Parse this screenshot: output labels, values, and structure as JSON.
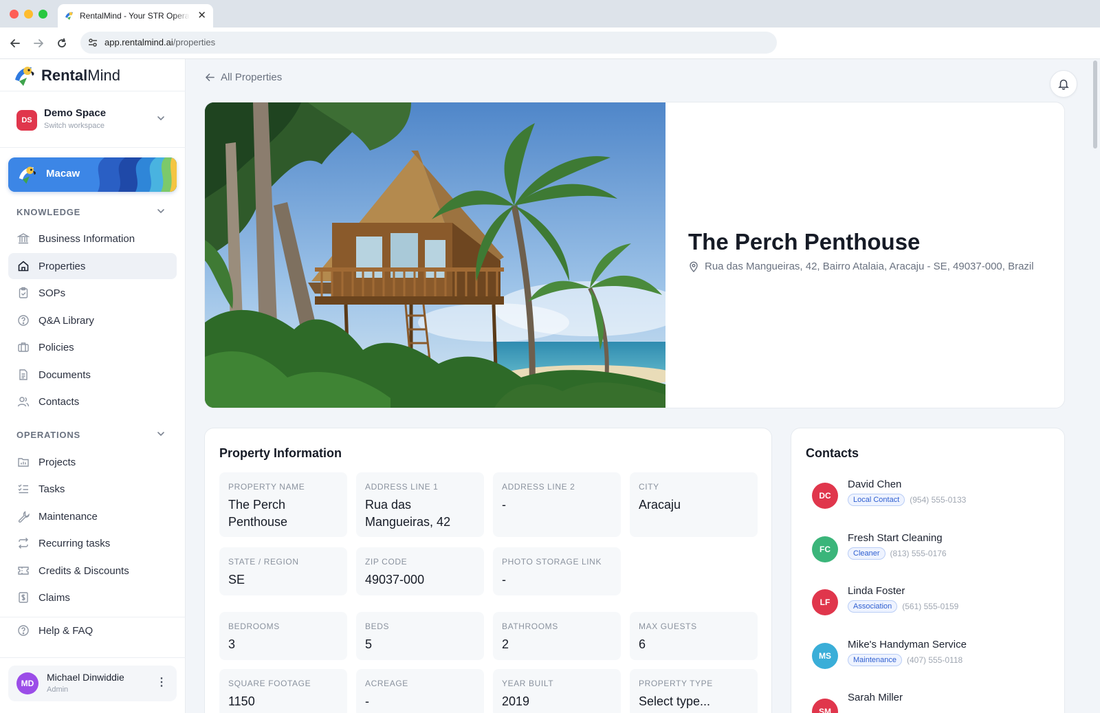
{
  "browser": {
    "tab_title": "RentalMind - Your STR Operations",
    "url_domain": "app.rentalmind.ai",
    "url_path": "/properties"
  },
  "sidebar": {
    "brand_first": "Rental",
    "brand_second": "Mind",
    "workspace": {
      "initials": "DS",
      "name": "Demo Space",
      "subtitle": "Switch workspace",
      "color": "#e0364c"
    },
    "macaw_label": "Macaw",
    "knowledge_heading": "KNOWLEDGE",
    "knowledge_items": [
      {
        "label": "Business Information",
        "icon": "bank-icon"
      },
      {
        "label": "Properties",
        "icon": "home-icon",
        "active": true
      },
      {
        "label": "SOPs",
        "icon": "clipboard-check-icon"
      },
      {
        "label": "Q&A Library",
        "icon": "question-circle-icon"
      },
      {
        "label": "Policies",
        "icon": "briefcase-icon"
      },
      {
        "label": "Documents",
        "icon": "document-icon"
      },
      {
        "label": "Contacts",
        "icon": "users-icon"
      }
    ],
    "operations_heading": "OPERATIONS",
    "operations_items": [
      {
        "label": "Projects",
        "icon": "folder-chart-icon"
      },
      {
        "label": "Tasks",
        "icon": "checklist-icon"
      },
      {
        "label": "Maintenance",
        "icon": "wrench-icon"
      },
      {
        "label": "Recurring tasks",
        "icon": "repeat-icon"
      },
      {
        "label": "Credits & Discounts",
        "icon": "ticket-icon"
      },
      {
        "label": "Claims",
        "icon": "dollar-file-icon"
      }
    ],
    "help_label": "Help & FAQ",
    "user": {
      "initials": "MD",
      "name": "Michael Dinwiddie",
      "role": "Admin",
      "color": "#9b4de8"
    }
  },
  "main": {
    "back_label": "All Properties",
    "property": {
      "title": "The Perch Penthouse",
      "address": "Rua das Mangueiras, 42, Bairro Atalaia, Aracaju - SE, 49037-000, Brazil"
    },
    "info_title": "Property Information",
    "fields": [
      {
        "label": "PROPERTY NAME",
        "value": "The Perch Penthouse"
      },
      {
        "label": "ADDRESS LINE 1",
        "value": "Rua das Mangueiras, 42"
      },
      {
        "label": "ADDRESS LINE 2",
        "value": "-"
      },
      {
        "label": "CITY",
        "value": "Aracaju"
      },
      {
        "label": "STATE / REGION",
        "value": "SE"
      },
      {
        "label": "ZIP CODE",
        "value": "49037-000"
      },
      {
        "label": "PHOTO STORAGE LINK",
        "value": "-"
      },
      {
        "label": "BEDROOMS",
        "value": "3"
      },
      {
        "label": "BEDS",
        "value": "5"
      },
      {
        "label": "BATHROOMS",
        "value": "2"
      },
      {
        "label": "MAX GUESTS",
        "value": "6"
      },
      {
        "label": "SQUARE FOOTAGE",
        "value": "1150"
      },
      {
        "label": "ACREAGE",
        "value": "-"
      },
      {
        "label": "YEAR BUILT",
        "value": "2019"
      },
      {
        "label": "PROPERTY TYPE",
        "value": "Select type..."
      }
    ],
    "contacts_title": "Contacts",
    "contacts": [
      {
        "initials": "DC",
        "name": "David Chen",
        "tag": "Local Contact",
        "phone": "(954) 555-0133",
        "color": "#e0364c"
      },
      {
        "initials": "FC",
        "name": "Fresh Start Cleaning",
        "tag": "Cleaner",
        "phone": "(813) 555-0176",
        "color": "#3bb57a"
      },
      {
        "initials": "LF",
        "name": "Linda Foster",
        "tag": "Association",
        "phone": "(561) 555-0159",
        "color": "#e0364c"
      },
      {
        "initials": "MS",
        "name": "Mike's Handyman Service",
        "tag": "Maintenance",
        "phone": "(407) 555-0118",
        "color": "#3aaed8"
      },
      {
        "initials": "SM",
        "name": "Sarah Miller",
        "tag": "",
        "phone": "",
        "color": "#e0364c"
      }
    ]
  }
}
